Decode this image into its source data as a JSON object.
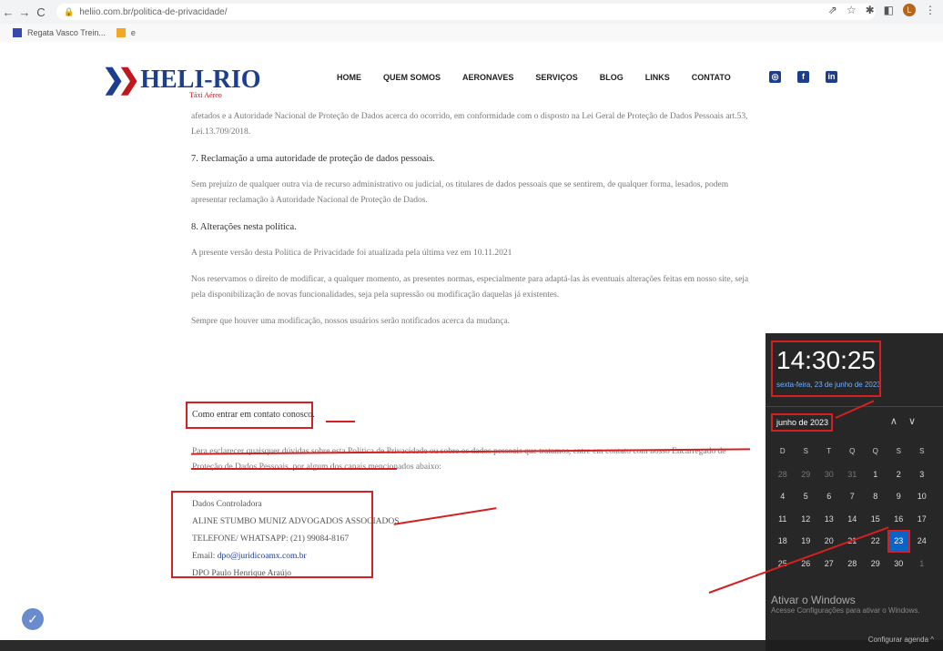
{
  "browser": {
    "url": "heliio.com.br/politica-de-privacidade/",
    "bookmarks": [
      "Regata Vasco Trein...",
      "e"
    ]
  },
  "site": {
    "logo_text": "HELI-RIO",
    "logo_sub": "Táxi Aéreo",
    "menu": [
      "HOME",
      "QUEM SOMOS",
      "AERONAVES",
      "SERVIÇOS",
      "BLOG",
      "LINKS",
      "CONTATO"
    ],
    "social": [
      "instagram-icon",
      "facebook-icon",
      "linkedin-icon"
    ]
  },
  "content": {
    "p1": "afetados e a Autoridade Nacional de Proteção de Dados acerca do ocorrido, em conformidade com o disposto na Lei Geral de Proteção de Dados Pessoais art.53, Lei.13.709/2018.",
    "h7": "7. Reclamação a uma autoridade de proteção de dados pessoais.",
    "p2": "Sem prejuízo de qualquer outra via de recurso administrativo ou judicial, os titulares de dados pessoais que se sentirem, de qualquer forma, lesados, podem apresentar reclamação à Autoridade Nacional de Proteção de Dados.",
    "h8": "8. Alterações nesta política.",
    "p3": "A presente versão desta Política de Privacidade foi atualizada pela última vez em 10.11.2021",
    "p4": "Nos reservamos o direito de modificar, a qualquer momento, as presentes normas, especialmente para adaptá-las às eventuais alterações feitas em nosso site, seja pela disponibilização de novas funcionalidades, seja pela supressão ou modificação daquelas já existentes.",
    "p5": "Sempre que houver uma modificação, nossos usuários serão notificados acerca da mudança.",
    "contact_title": "Como entrar em contato conosco.",
    "contact_text": "Para esclarecer quaisquer dúvidas sobre esta Política de Privacidade ou sobre os dados pessoais que tratamos, entre em contato com nosso Encarregado de Proteção de Dados Pessoais, por algum dos canais mencionados abaixo:",
    "dados": {
      "title": "Dados Controladora",
      "company": "ALINE STUMBO MUNIZ ADVOGADOS ASSOCIADOS",
      "phone": "TELEFONE/ WHATSAPP: (21) 99084-8167",
      "email_label": "Email: ",
      "email": "dpo@juridicoamx.com.br",
      "dpo": "DPO Paulo Henrique Araújo"
    }
  },
  "calendar": {
    "time": "14:30:25",
    "date": "sexta-feira, 23 de junho de 2023",
    "month": "junho de 2023",
    "weekdays": [
      "D",
      "S",
      "T",
      "Q",
      "Q",
      "S",
      "S"
    ],
    "days": [
      {
        "d": "28",
        "m": true
      },
      {
        "d": "29",
        "m": true
      },
      {
        "d": "30",
        "m": true
      },
      {
        "d": "31",
        "m": true
      },
      {
        "d": "1"
      },
      {
        "d": "2"
      },
      {
        "d": "3"
      },
      {
        "d": "4"
      },
      {
        "d": "5"
      },
      {
        "d": "6"
      },
      {
        "d": "7"
      },
      {
        "d": "8"
      },
      {
        "d": "9"
      },
      {
        "d": "10"
      },
      {
        "d": "11"
      },
      {
        "d": "12"
      },
      {
        "d": "13"
      },
      {
        "d": "14"
      },
      {
        "d": "15"
      },
      {
        "d": "16"
      },
      {
        "d": "17"
      },
      {
        "d": "18"
      },
      {
        "d": "19"
      },
      {
        "d": "20"
      },
      {
        "d": "21"
      },
      {
        "d": "22"
      },
      {
        "d": "23",
        "t": true
      },
      {
        "d": "24"
      },
      {
        "d": "25"
      },
      {
        "d": "26"
      },
      {
        "d": "27"
      },
      {
        "d": "28"
      },
      {
        "d": "29"
      },
      {
        "d": "30"
      },
      {
        "d": "1",
        "m": true
      }
    ],
    "watermark": "Ativar o Windows",
    "watermark_sub": "Acesse Configurações para ativar o Windows.",
    "footer": "Configurar agenda ^"
  }
}
